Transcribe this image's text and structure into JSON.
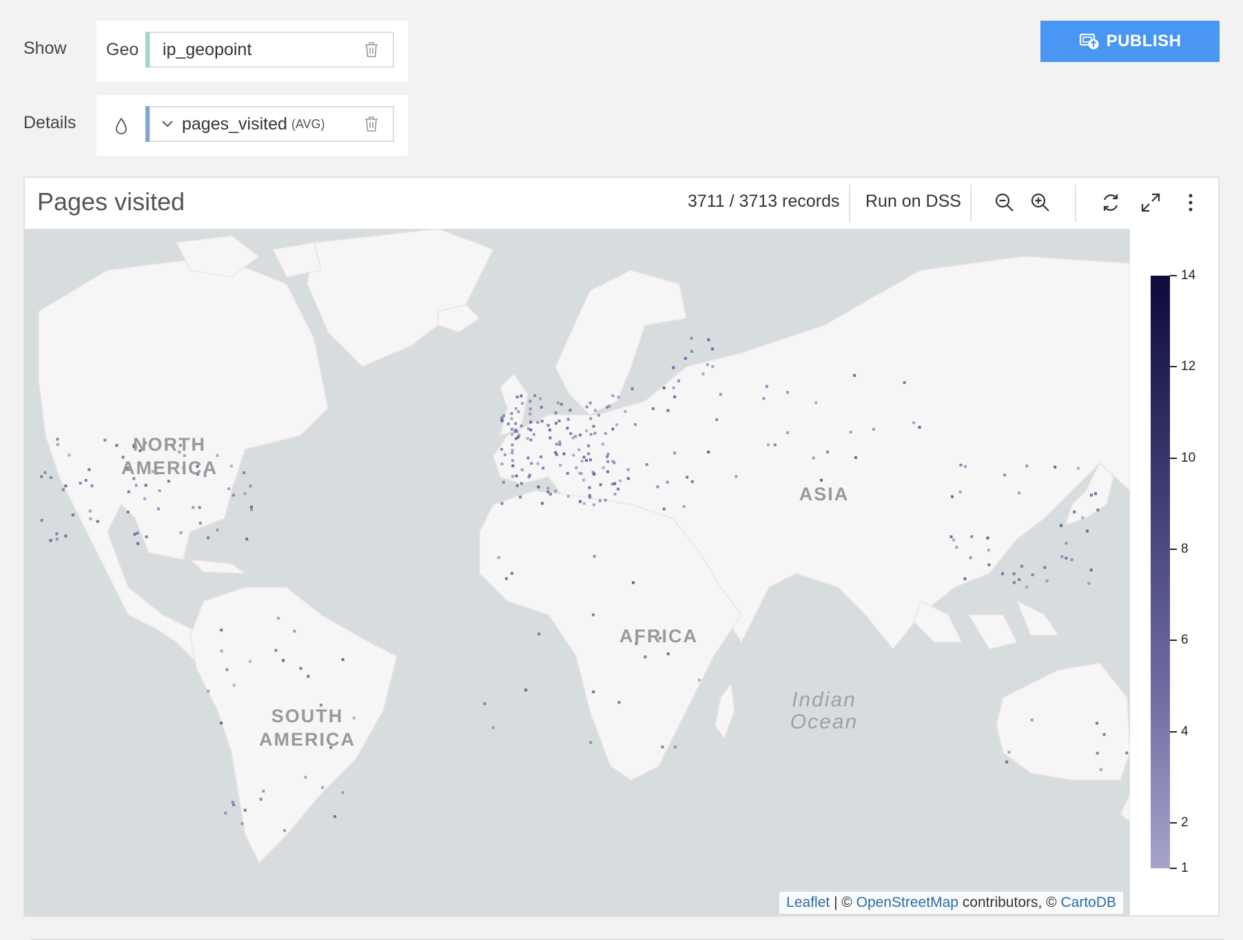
{
  "show": {
    "label": "Show",
    "geo_label": "Geo",
    "geo_field": "ip_geopoint",
    "geo_color": "#9bd8c8"
  },
  "details": {
    "label": "Details",
    "field": "pages_visited",
    "aggregation": "(AVG)",
    "field_color": "#7fa6dc",
    "icons": [
      "drop-icon",
      "chevron-down-icon",
      "trash-icon"
    ]
  },
  "toolbar": {
    "publish_label": "PUBLISH",
    "publish_color": "#4a97f3"
  },
  "chart": {
    "title": "Pages visited",
    "records": "3711 / 3713 records",
    "run_label": "Run on DSS",
    "tools": [
      "zoom-out-icon",
      "zoom-in-icon",
      "refresh-icon",
      "fullscreen-icon",
      "more-icon"
    ]
  },
  "map": {
    "continents": [
      "NORTH AMERICA",
      "SOUTH AMERICA",
      "AFRICA",
      "ASIA"
    ],
    "ocean": "Indian Ocean",
    "attribution": {
      "leaflet": "Leaflet",
      "sep": " | © ",
      "osm": "OpenStreetMap",
      "mid": " contributors, © ",
      "carto": "CartoDB"
    },
    "colors": {
      "water": "#d7dcdf",
      "land": "#f6f6f6",
      "point": "#5b5a98"
    }
  },
  "legend": {
    "ticks": [
      "14",
      "12",
      "10",
      "8",
      "6",
      "4",
      "2",
      "1"
    ],
    "min": 1,
    "max": 14,
    "colors": [
      "#0c0b3a",
      "#a6a4cc"
    ]
  }
}
